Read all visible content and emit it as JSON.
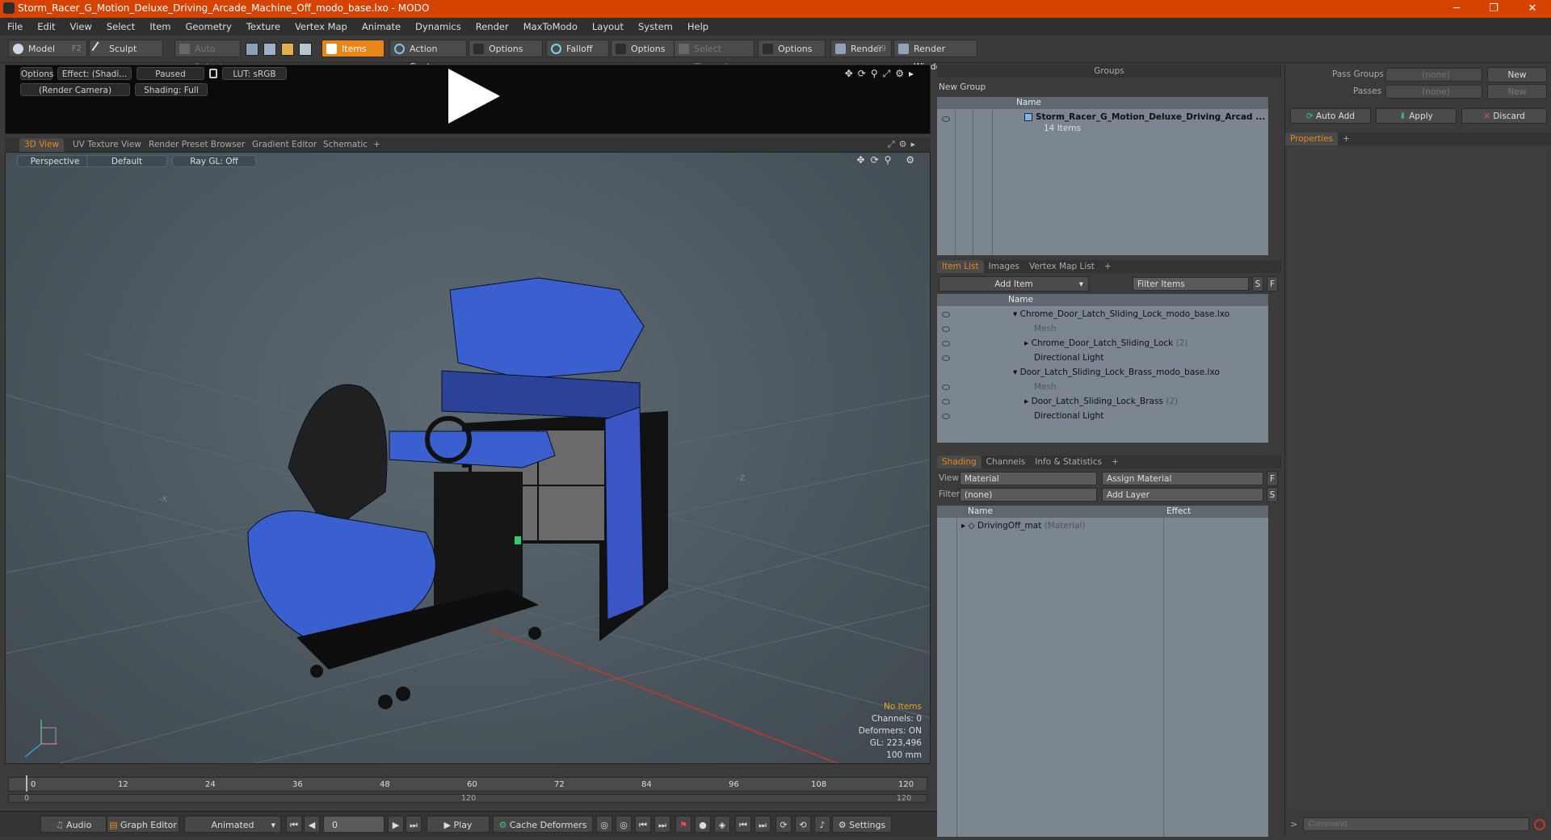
{
  "window": {
    "title": "Storm_Racer_G_Motion_Deluxe_Driving_Arcade_Machine_Off_modo_base.lxo - MODO",
    "minimize": "─",
    "restore": "❐",
    "close": "✕"
  },
  "menubar": [
    "File",
    "Edit",
    "View",
    "Select",
    "Item",
    "Geometry",
    "Texture",
    "Vertex Map",
    "Animate",
    "Dynamics",
    "Render",
    "MaxToModo",
    "Layout",
    "System",
    "Help"
  ],
  "toolbar": {
    "model": "Model",
    "model_hotkey": "F2",
    "sculpt": "Sculpt",
    "auto_select": "Auto Select",
    "items": "Items",
    "action_center": "Action Center",
    "options1": "Options",
    "falloff": "Falloff",
    "options2": "Options",
    "select_through": "Select Through",
    "options3": "Options",
    "render": "Render",
    "render_hotkey": "F9",
    "render_window": "Render Window"
  },
  "preview": {
    "options": "Options",
    "effect": "Effect: (Shadi...",
    "paused": "Paused",
    "lut": "LUT: sRGB",
    "camera": "(Render Camera)",
    "shading": "Shading: Full"
  },
  "viewport_tabs": [
    "3D View",
    "UV Texture View",
    "Render Preset Browser",
    "Gradient Editor",
    "Schematic",
    "+"
  ],
  "viewport": {
    "projection": "Perspective",
    "style": "Default",
    "raygl": "Ray GL: Off",
    "axis_x": "-X",
    "axis_z": "-Z",
    "hud": {
      "items": "No Items",
      "channels": "Channels: 0",
      "deformers": "Deformers: ON",
      "gl": "GL: 223,496",
      "scale": "100 mm"
    }
  },
  "timeline": {
    "ticks": [
      "0",
      "12",
      "24",
      "36",
      "48",
      "60",
      "72",
      "84",
      "96",
      "108",
      "120"
    ],
    "sub_start": "0",
    "sub_mid": "120",
    "sub_end": "120"
  },
  "transport": {
    "audio": "Audio",
    "graph_editor": "Graph Editor",
    "animated": "Animated",
    "frame": "0",
    "play": "Play",
    "cache_deformers": "Cache Deformers",
    "settings": "Settings"
  },
  "groups": {
    "title": "Groups",
    "new_group": "New Group",
    "col_name": "Name",
    "item_name": "Storm_Racer_G_Motion_Deluxe_Driving_Arcad ...",
    "item_count": "14 Items"
  },
  "item_list": {
    "tabs": [
      "Item List",
      "Images",
      "Vertex Map List",
      "+"
    ],
    "add_item": "Add Item",
    "filter": "Filter Items",
    "s": "S",
    "f": "F",
    "col_name": "Name",
    "rows": [
      {
        "text": "Chrome_Door_Latch_Sliding_Lock_modo_base.lxo",
        "extra": ""
      },
      {
        "text": "Mesh",
        "extra": ""
      },
      {
        "text": "Chrome_Door_Latch_Sliding_Lock",
        "extra": "(2)"
      },
      {
        "text": "Directional Light",
        "extra": ""
      },
      {
        "text": "Door_Latch_Sliding_Lock_Brass_modo_base.lxo",
        "extra": ""
      },
      {
        "text": "Mesh",
        "extra": ""
      },
      {
        "text": "Door_Latch_Sliding_Lock_Brass",
        "extra": "(2)"
      },
      {
        "text": "Directional Light",
        "extra": ""
      }
    ]
  },
  "shading": {
    "tabs": [
      "Shading",
      "Channels",
      "Info & Statistics",
      "+"
    ],
    "view_label": "View",
    "view_value": "Material",
    "assign_material": "Assign Material",
    "f": "F",
    "filter_label": "Filter",
    "filter_value": "(none)",
    "add_layer": "Add Layer",
    "s": "S",
    "col_name": "Name",
    "col_effect": "Effect",
    "row_name": "DrivingOff_mat",
    "row_type": "(Material)"
  },
  "right_panel": {
    "pass_groups_label": "Pass Groups",
    "pass_groups_value": "(none)",
    "passes_label": "Passes",
    "passes_value": "(none)",
    "new1": "New",
    "new2": "New",
    "auto_add": "Auto Add",
    "apply": "Apply",
    "discard": "Discard",
    "properties_tab": "Properties",
    "plus": "+",
    "command_placeholder": "Command"
  },
  "colors": {
    "accent": "#e8861a",
    "titlebar": "#d64300",
    "mesh_blue": "#3a5fcf"
  }
}
